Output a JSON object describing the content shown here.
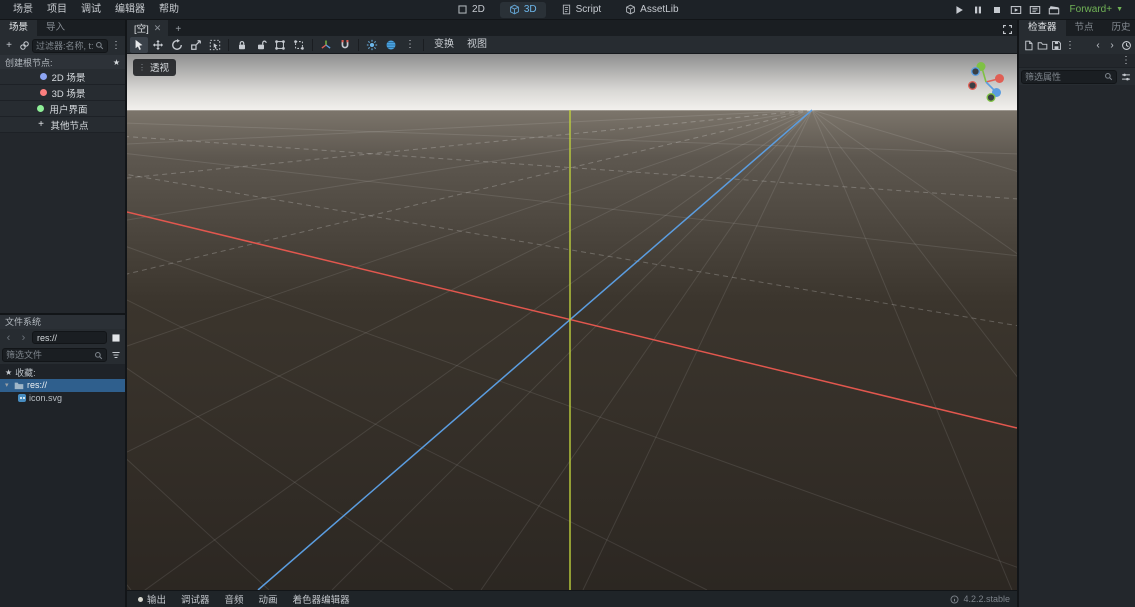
{
  "menubar": {
    "items": [
      {
        "label": "场景"
      },
      {
        "label": "项目"
      },
      {
        "label": "调试"
      },
      {
        "label": "编辑器"
      },
      {
        "label": "帮助"
      }
    ]
  },
  "workspaces": {
    "items": [
      {
        "label": "2D"
      },
      {
        "label": "3D",
        "active": true
      },
      {
        "label": "Script"
      },
      {
        "label": "AssetLib"
      }
    ]
  },
  "runbar": {
    "renderer": "Forward+"
  },
  "scene_dock": {
    "tabs": [
      {
        "label": "场景",
        "active": true
      },
      {
        "label": "导入",
        "active": false
      }
    ],
    "add_label": "+",
    "filter_placeholder": "过滤器:名称, t:类型",
    "create_root_label": "创建根节点:",
    "root_options": [
      {
        "label": "2D 场景",
        "color": "#8da5f3"
      },
      {
        "label": "3D 场景",
        "color": "#fc7f7f"
      },
      {
        "label": "用户界面",
        "color": "#8eef97"
      },
      {
        "label": "其他节点",
        "color": "#e0e0e0"
      }
    ]
  },
  "filesystem_dock": {
    "title": "文件系统",
    "path": "res://",
    "filter_placeholder": "筛选文件",
    "favorites_label": "收藏:",
    "tree": [
      {
        "label": "res://",
        "type": "folder",
        "selected": true
      },
      {
        "label": "icon.svg",
        "type": "file",
        "selected": false
      }
    ]
  },
  "scene_tabs": {
    "tabs": [
      {
        "label": "[空]",
        "active": true
      }
    ],
    "close_glyph": "✕",
    "new_tab_glyph": "+"
  },
  "viewport": {
    "camera_label": "透视",
    "transform_menu_label": "变换",
    "view_menu_label": "视图",
    "axis_colors": {
      "x": "#e2574e",
      "y": "#bed03c",
      "z": "#5b9de0"
    }
  },
  "inspector_dock": {
    "tabs": [
      {
        "label": "检查器",
        "active": true
      },
      {
        "label": "节点",
        "active": false
      },
      {
        "label": "历史",
        "active": false
      }
    ],
    "filter_placeholder": "筛选属性"
  },
  "bottom_panel": {
    "items": [
      {
        "label": "输出"
      },
      {
        "label": "调试器"
      },
      {
        "label": "音频"
      },
      {
        "label": "动画"
      },
      {
        "label": "着色器编辑器"
      }
    ],
    "version": "4.2.2.stable"
  },
  "colors": {
    "accent_blue": "#6cb6ea",
    "renderer_green": "#71b356",
    "selection_blue": "#2f5f8d"
  }
}
